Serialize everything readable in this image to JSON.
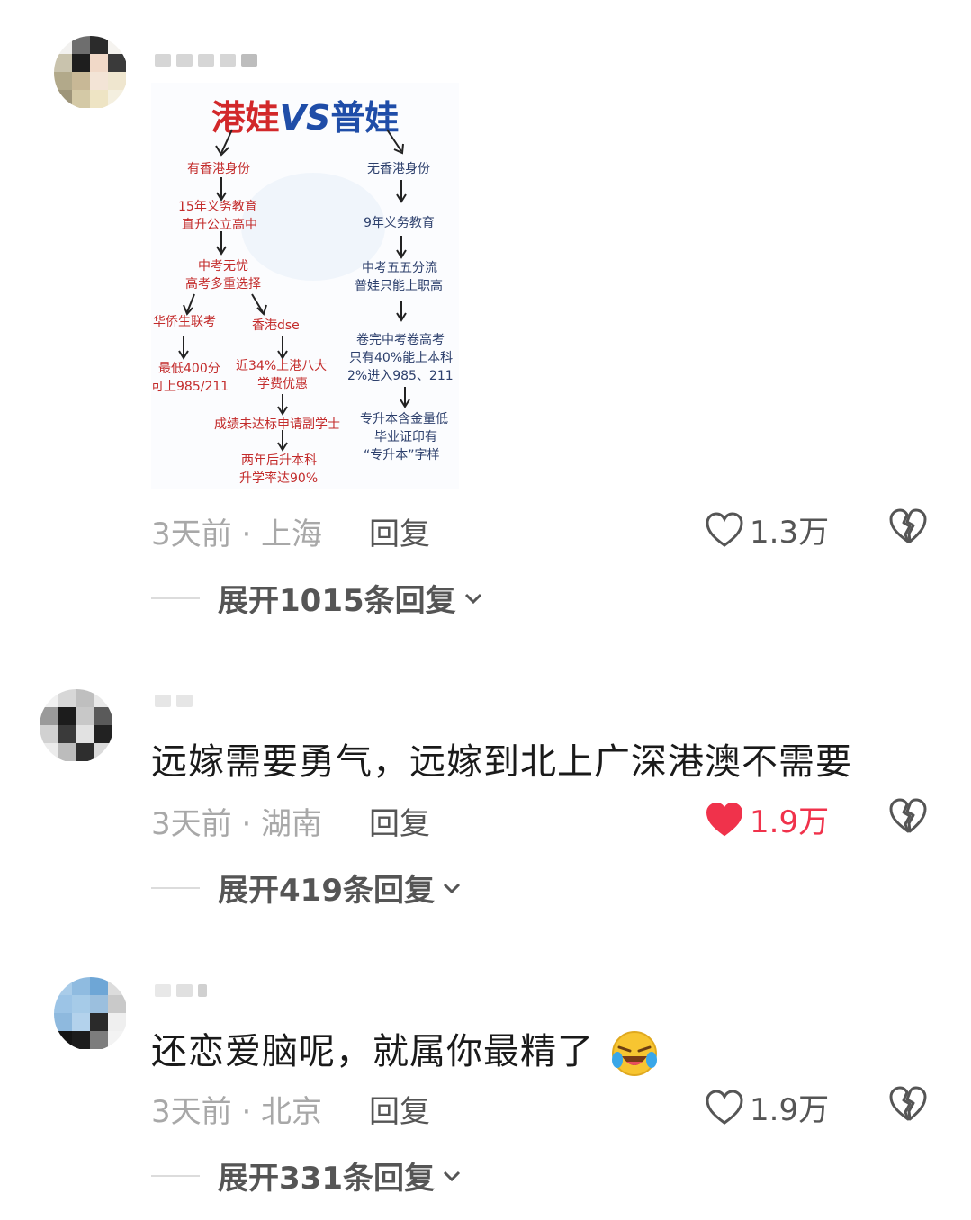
{
  "comments": [
    {
      "image": {
        "title_left": "港娃",
        "title_vs": "VS",
        "title_right": "普娃",
        "left_nodes": [
          "有香港身份",
          "15年义务教育",
          "直升公立高中",
          "中考无忧",
          "高考多重选择",
          "华侨生联考",
          "香港dse",
          "最低400分",
          "可上985/211",
          "近34%上港八大",
          "学费优惠",
          "成绩未达标申请副学士",
          "两年后升本科",
          "升学率达90%"
        ],
        "right_nodes": [
          "无香港身份",
          "9年义务教育",
          "中考五五分流",
          "普娃只能上职高",
          "卷完中考卷高考",
          "只有40%能上本科",
          "2%进入985、211",
          "专升本含金量低",
          "毕业证印有",
          "“专升本”字样"
        ]
      },
      "time_location": "3天前 · 上海",
      "reply_label": "回复",
      "like_count": "1.3万",
      "liked": false,
      "expand_label": "展开1015条回复"
    },
    {
      "text": "远嫁需要勇气，远嫁到北上广深港澳不需要",
      "time_location": "3天前 · 湖南",
      "reply_label": "回复",
      "like_count": "1.9万",
      "liked": true,
      "expand_label": "展开419条回复"
    },
    {
      "text": "还恋爱脑呢，就属你最精了",
      "emoji": "crying-laughing-emoji",
      "time_location": "3天前 · 北京",
      "reply_label": "回复",
      "like_count": "1.9万",
      "liked": false,
      "expand_label": "展开331条回复"
    }
  ],
  "colors": {
    "liked": "#f0324b",
    "meta_gray": "#a8a8a8",
    "action_gray": "#555555",
    "hk_red": "#d2282a",
    "pu_blue": "#1f4da8"
  }
}
